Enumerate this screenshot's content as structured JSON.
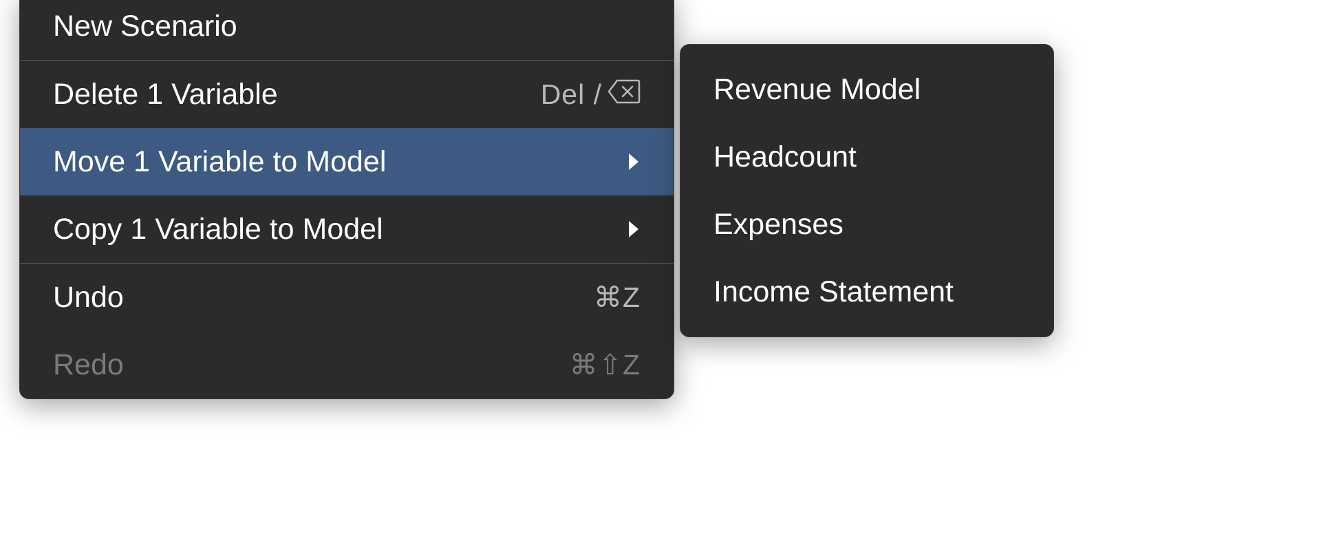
{
  "menu": {
    "items": [
      {
        "label": "New Scenario"
      },
      {
        "label": "Delete 1 Variable",
        "shortcut": "Del /"
      },
      {
        "label": "Move 1 Variable to Model"
      },
      {
        "label": "Copy 1 Variable to Model"
      },
      {
        "label": "Undo",
        "shortcut": "⌘Z"
      },
      {
        "label": "Redo",
        "shortcut": "⌘⇧Z"
      }
    ]
  },
  "submenu": {
    "items": [
      {
        "label": "Revenue Model"
      },
      {
        "label": "Headcount"
      },
      {
        "label": "Expenses"
      },
      {
        "label": "Income Statement"
      }
    ]
  }
}
